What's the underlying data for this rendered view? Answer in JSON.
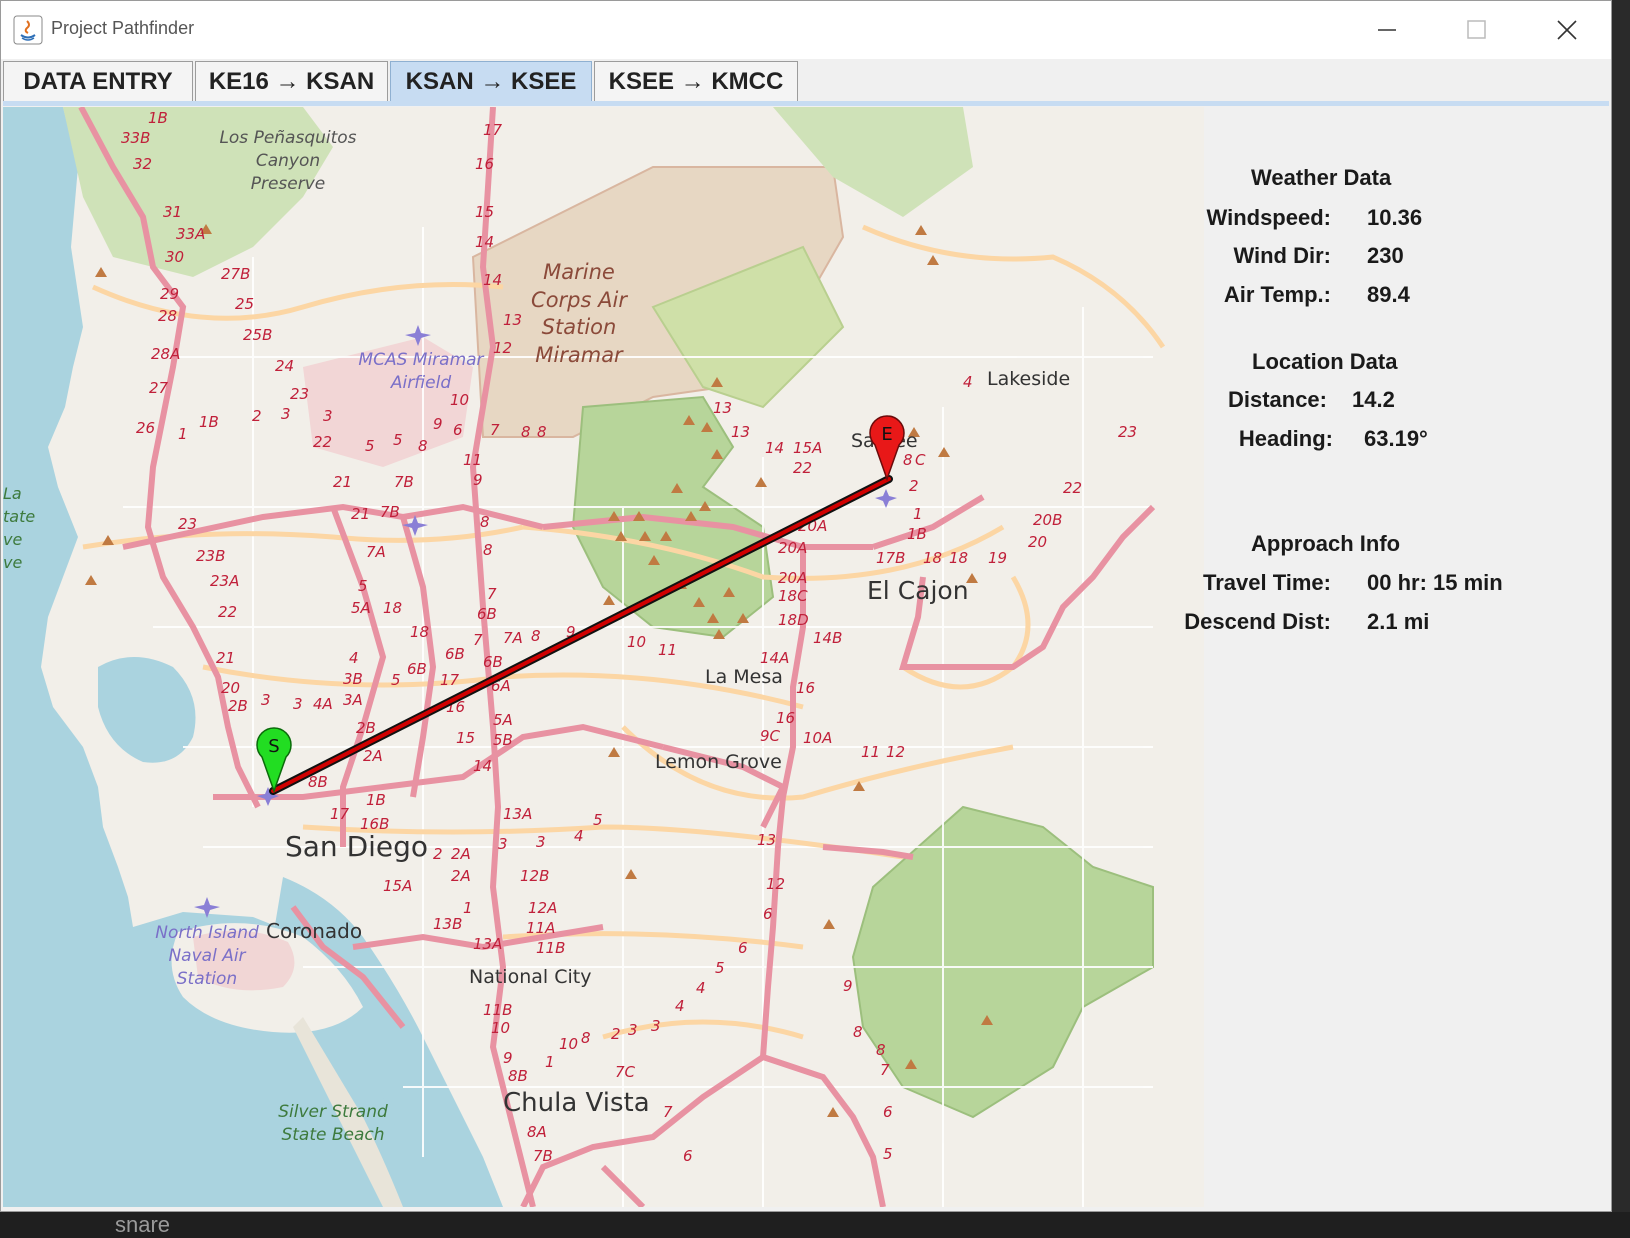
{
  "window": {
    "title": "Project Pathfinder"
  },
  "tabs": [
    {
      "label": "DATA ENTRY"
    },
    {
      "label": "KE16 → KSAN"
    },
    {
      "label": "KSAN → KSEE"
    },
    {
      "label": "KSEE → KMCC"
    }
  ],
  "active_tab_index": 2,
  "weather": {
    "heading": "Weather Data",
    "windspeed_label": "Windspeed:",
    "windspeed_value": "10.36",
    "winddir_label": "Wind Dir:",
    "winddir_value": "230",
    "airtemp_label": "Air Temp.:",
    "airtemp_value": "89.4"
  },
  "location": {
    "heading": "Location Data",
    "distance_label": "Distance:",
    "distance_value": "14.2",
    "heading_label": "Heading:",
    "heading_value": "63.19°"
  },
  "approach": {
    "heading": "Approach Info",
    "travel_label": "Travel Time:",
    "travel_value": "00 hr: 15 min",
    "descend_label": "Descend Dist:",
    "descend_value": "2.1 mi"
  },
  "map": {
    "start_marker": "S",
    "end_marker": "E",
    "route_color": "#d00000",
    "labels": {
      "penasquitos_1": "Los Peñasquitos",
      "penasquitos_2": "Canyon",
      "penasquitos_3": "Preserve",
      "marine_1": "Marine",
      "marine_2": "Corps Air",
      "marine_3": "Station",
      "marine_4": "Miramar",
      "mcas_1": "MCAS Miramar",
      "mcas_2": "Airfield",
      "lakeside": "Lakeside",
      "santee": "Santee",
      "elcajon": "El Cajon",
      "lamesa": "La Mesa",
      "lemongrove": "Lemon Grove",
      "sandiego": "San Diego",
      "northisland_1": "North Island",
      "northisland_2": "Naval Air",
      "northisland_3": "Station",
      "coronado": "Coronado",
      "nationalcity": "National City",
      "chulavista": "Chula Vista",
      "silverstrand_1": "Silver Strand",
      "silverstrand_2": "State Beach",
      "lajolla_1": "La",
      "lajolla_2": "tate",
      "lajolla_3": "ve",
      "lajolla_4": "ve"
    }
  },
  "background": {
    "taskbar_text": "snare"
  },
  "colors": {
    "tab_active": "#c7dcf2",
    "water": "#aad3df",
    "land": "#f2efe9",
    "park": "#c8e0a8",
    "military": "#e6d5c0",
    "highway": "#e892a2",
    "primary_road": "#fcd6a4"
  }
}
